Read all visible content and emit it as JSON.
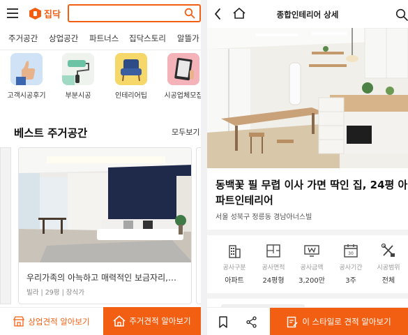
{
  "left": {
    "brand": {
      "name": "집닥",
      "color": "#f35f12"
    },
    "search": {
      "placeholder": ""
    },
    "nav_tabs": [
      "주거공간",
      "상업공간",
      "파트너스",
      "집닥스토리",
      "알뜰가"
    ],
    "categories": [
      {
        "label": "고객시공후기",
        "icon": "thumbs-up-icon"
      },
      {
        "label": "부분시공",
        "icon": "paint-roller-icon"
      },
      {
        "label": "인테리어팁",
        "icon": "armchair-icon"
      },
      {
        "label": "시공업체모집",
        "icon": "tablet-icon"
      }
    ],
    "section": {
      "title": "베스트 주거공간",
      "see_all": "모두보기"
    },
    "card": {
      "title": "우리가족의 아늑하고 매력적인 보금자리,…",
      "meta": "빌라 | 29평 | 장식가"
    },
    "bottom": {
      "business_estimate": "상업견적 알아보기",
      "home_estimate": "주거견적 알아보기"
    }
  },
  "right": {
    "header_title": "종합인테리어 상세",
    "title": "동백꽃 필 무렵 이사 가면 딱인 집, 24평 아파트인테리어",
    "location": "서울 성북구 정릉동 경남아너스빌",
    "specs": [
      {
        "label": "공사구분",
        "value": "아파트",
        "icon": "building-icon"
      },
      {
        "label": "공사면적",
        "value": "24평형",
        "icon": "floorplan-icon"
      },
      {
        "label": "공사금액",
        "value": "3,200만",
        "icon": "won-price-icon"
      },
      {
        "label": "공사기간",
        "value": "3주",
        "icon": "calendar-icon"
      },
      {
        "label": "시공범위",
        "value": "전체",
        "icon": "tools-icon"
      }
    ],
    "bottom": {
      "style_estimate": "이 스타일로 견적 알아보기"
    }
  }
}
